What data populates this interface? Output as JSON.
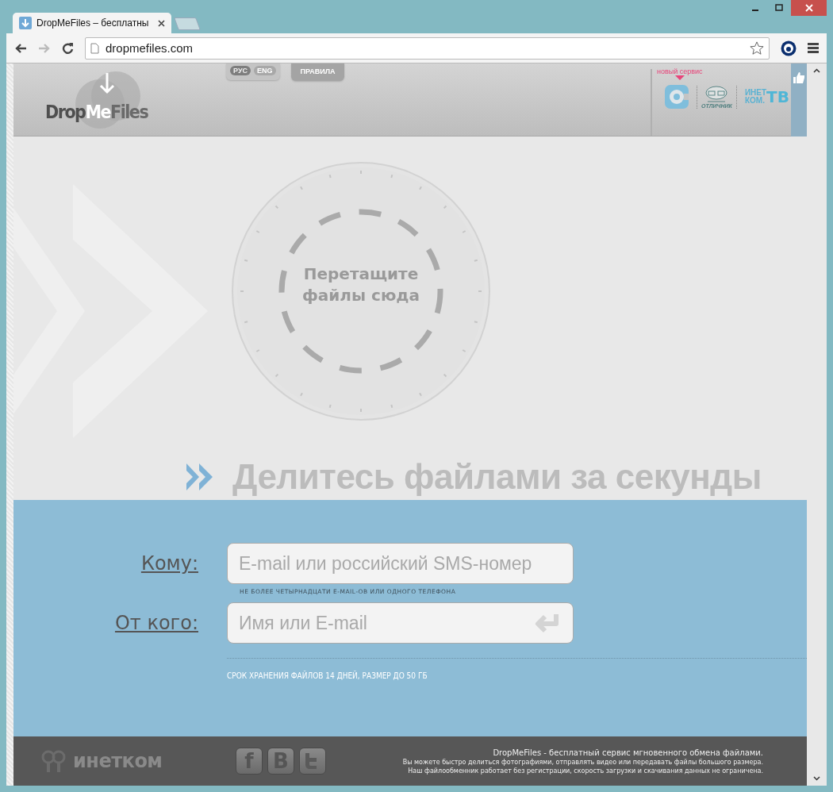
{
  "browser": {
    "tab_title": "DropMeFiles – бесплатны",
    "url": "dropmefiles.com"
  },
  "header": {
    "logo": {
      "part_1": "Drop",
      "part_2": "Me",
      "part_3": "Files"
    },
    "languages": [
      {
        "label": "РУС",
        "selected": true
      },
      {
        "label": "ENG",
        "selected": false
      }
    ],
    "rules_link": "ПРАВИЛА",
    "new_service_label": "новый сервис",
    "otlichnik_text": "ОТЛИЧНИК",
    "tv_logo": {
      "line_1": "ИНЕТ",
      "line_2": "КОМ.",
      "suffix": "ТВ"
    }
  },
  "drop_zone": {
    "text": "Перетащите файлы сюда"
  },
  "tagline": "Делитесь файлами за секунды",
  "form": {
    "to_label": "Кому:",
    "to_placeholder": "E-mail или российский SMS-номер",
    "to_hint": "НЕ БОЛЕЕ ЧЕТЫРНАДЦАТИ E-MAIL-ОВ ИЛИ ОДНОГО ТЕЛЕФОНА",
    "from_label": "От кого:",
    "from_placeholder": "Имя или E-mail",
    "note": "СРОК ХРАНЕНИЯ ФАЙЛОВ 14 ДНЕЙ, РАЗМЕР ДО 50 ГБ"
  },
  "footer": {
    "logo": "инетком",
    "social": [
      {
        "kind": "facebook",
        "label": "f"
      },
      {
        "kind": "vk",
        "label": "B"
      },
      {
        "kind": "twitter"
      }
    ],
    "lines": [
      "DropMeFiles - бесплатный сервис мгновенного обмена файлами.",
      "Вы можете быстро делиться фотографиями, отправлять видео или передавать файлы большого размера.",
      "Наш файлообменник работает без регистрации, скорость загрузки и скачивания данных не ограничена."
    ]
  }
}
